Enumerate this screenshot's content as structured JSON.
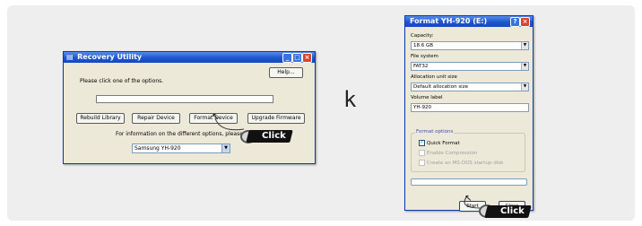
{
  "recovery_window": {
    "title": "Recovery Utility",
    "help_label": "Help...",
    "prompt": "Please click one of the options.",
    "buttons": [
      "Rebuild Library",
      "Repair Device",
      "Format Device",
      "Upgrade Firmware"
    ],
    "info_text": "For information on the different options, please click",
    "device_select": "Samsung YH-920"
  },
  "separator_letter": "k",
  "format_dialog": {
    "title": "Format YH-920 (E:)",
    "capacity_label": "Capacity:",
    "capacity_value": "18.6 GB",
    "filesystem_label": "File system",
    "filesystem_value": "FAT32",
    "allocation_label": "Allocation unit size",
    "allocation_value": "Default allocation size",
    "volume_label": "Volume label",
    "volume_value": "YH-920",
    "options_group": "Format options",
    "options": [
      {
        "label": "Quick Format",
        "checked": true,
        "enabled": true
      },
      {
        "label": "Enable Compression",
        "checked": false,
        "enabled": false
      },
      {
        "label": "Create an MS-DOS startup disk",
        "checked": false,
        "enabled": false
      }
    ],
    "start_label": "Start",
    "close_label": "Close"
  },
  "badges": {
    "click": "Click"
  }
}
